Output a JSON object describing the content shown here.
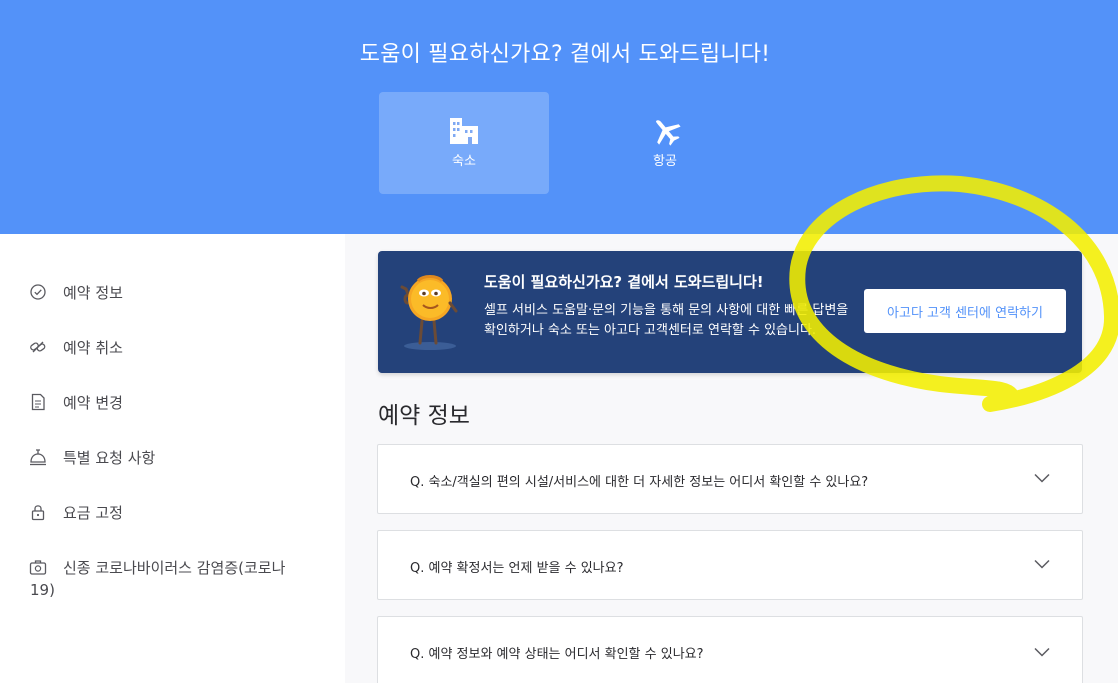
{
  "hero": {
    "title": "도움이 필요하신가요? 곁에서 도와드립니다!",
    "tabs": [
      {
        "label": "숙소",
        "icon": "hotel-icon",
        "active": true
      },
      {
        "label": "항공",
        "icon": "airplane-icon",
        "active": false
      }
    ]
  },
  "sidebar": {
    "items": [
      {
        "label": "예약 정보",
        "icon": "check-circle-icon"
      },
      {
        "label": "예약 취소",
        "icon": "cancel-link-icon"
      },
      {
        "label": "예약 변경",
        "icon": "document-icon"
      },
      {
        "label": "특별 요청 사항",
        "icon": "bell-service-icon"
      },
      {
        "label": "요금 고정",
        "icon": "lock-icon"
      },
      {
        "label": "신종 코로나바이러스 감염증(코로나",
        "label2": "19)",
        "icon": "medical-case-icon"
      }
    ]
  },
  "banner": {
    "title": "도움이 필요하신가요? 곁에서 도와드립니다!",
    "body": "셀프 서비스 도움말·문의 기능을 통해 문의 사항에 대한 빠른 답변을 확인하거나 숙소 또는 아고다 고객센터로 연락할 수 있습니다.",
    "button": "아고다 고객 센터에 연락하기",
    "mascot": "mascot-icon"
  },
  "section": {
    "title": "예약 정보"
  },
  "faqs": [
    {
      "question": "Q. 숙소/객실의 편의 시설/서비스에 대한 더 자세한 정보는 어디서 확인할 수 있나요?"
    },
    {
      "question": "Q. 예약 확정서는 언제 받을 수 있나요?"
    },
    {
      "question": "Q. 예약 정보와 예약 상태는 어디서 확인할 수 있나요?"
    }
  ],
  "colors": {
    "hero_bg": "#5392f9",
    "banner_bg": "#24427a",
    "accent": "#5392f9",
    "annotation": "#f4f000"
  }
}
